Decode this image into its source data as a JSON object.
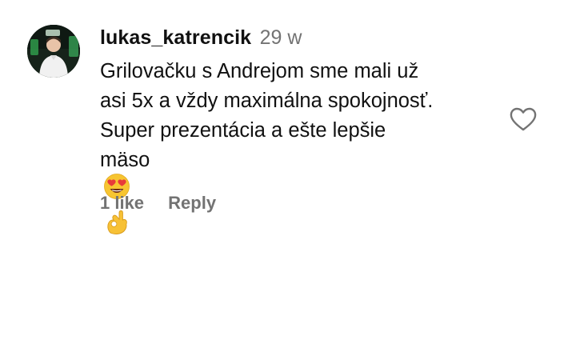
{
  "comment": {
    "username": "lukas_katrencik",
    "timestamp": "29 w",
    "text_lines": [
      "Grilovačku s Andrejom sme mali už",
      "asi 5x a vždy maximálna spokojnosť.",
      "Super prezentácia a ešte lepšie",
      "mäso"
    ],
    "emojis": [
      "heart-eyes-emoji",
      "ok-hand-emoji"
    ],
    "likes": "1 like",
    "reply_label": "Reply",
    "like_icon": "heart-outline-icon",
    "avatar_icon": "user-avatar"
  }
}
